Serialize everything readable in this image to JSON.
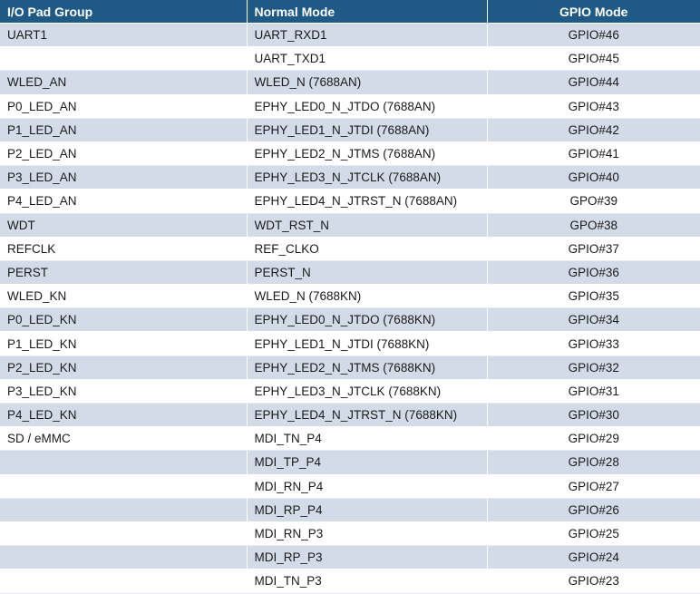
{
  "table": {
    "headers": [
      "I/O Pad Group",
      "Normal Mode",
      "GPIO Mode"
    ],
    "rows": [
      [
        "UART1",
        "UART_RXD1",
        "GPIO#46"
      ],
      [
        "",
        "UART_TXD1",
        "GPIO#45"
      ],
      [
        "WLED_AN",
        "WLED_N (7688AN)",
        "GPIO#44"
      ],
      [
        "P0_LED_AN",
        "EPHY_LED0_N_JTDO (7688AN)",
        "GPIO#43"
      ],
      [
        "P1_LED_AN",
        "EPHY_LED1_N_JTDI (7688AN)",
        "GPIO#42"
      ],
      [
        "P2_LED_AN",
        "EPHY_LED2_N_JTMS (7688AN)",
        "GPIO#41"
      ],
      [
        "P3_LED_AN",
        "EPHY_LED3_N_JTCLK (7688AN)",
        "GPIO#40"
      ],
      [
        "P4_LED_AN",
        "EPHY_LED4_N_JTRST_N (7688AN)",
        "GPO#39"
      ],
      [
        "WDT",
        "WDT_RST_N",
        "GPO#38"
      ],
      [
        "REFCLK",
        "REF_CLKO",
        "GPIO#37"
      ],
      [
        "PERST",
        "PERST_N",
        "GPIO#36"
      ],
      [
        "WLED_KN",
        "WLED_N  (7688KN)",
        "GPIO#35"
      ],
      [
        "P0_LED_KN",
        "EPHY_LED0_N_JTDO (7688KN)",
        "GPIO#34"
      ],
      [
        "P1_LED_KN",
        "EPHY_LED1_N_JTDI  (7688KN)",
        "GPIO#33"
      ],
      [
        "P2_LED_KN",
        "EPHY_LED2_N_JTMS  (7688KN)",
        "GPIO#32"
      ],
      [
        "P3_LED_KN",
        "EPHY_LED3_N_JTCLK (7688KN)",
        "GPIO#31"
      ],
      [
        "P4_LED_KN",
        "EPHY_LED4_N_JTRST_N  (7688KN)",
        "GPIO#30"
      ],
      [
        "SD / eMMC",
        "MDI_TN_P4",
        "GPIO#29"
      ],
      [
        "",
        "MDI_TP_P4",
        "GPIO#28"
      ],
      [
        "",
        "MDI_RN_P4",
        "GPIO#27"
      ],
      [
        "",
        "MDI_RP_P4",
        "GPIO#26"
      ],
      [
        "",
        "MDI_RN_P3",
        "GPIO#25"
      ],
      [
        "",
        "MDI_RP_P3",
        "GPIO#24"
      ],
      [
        "",
        "MDI_TN_P3",
        "GPIO#23"
      ]
    ]
  }
}
